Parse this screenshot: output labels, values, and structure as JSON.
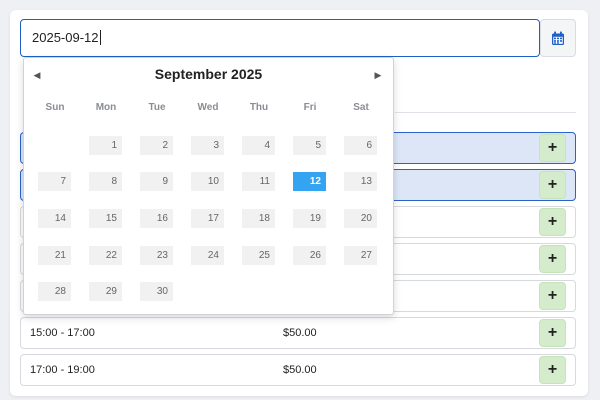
{
  "date_field": {
    "value": "2025-09-12"
  },
  "calendar_button": {
    "icon": "calendar-icon",
    "color": "#1f5fc7"
  },
  "picker": {
    "month_label": "September 2025",
    "prev_icon": "triangle-left-icon",
    "next_icon": "triangle-right-icon",
    "weekdays": [
      "Sun",
      "Mon",
      "Tue",
      "Wed",
      "Thu",
      "Fri",
      "Sat"
    ],
    "weeks": [
      [
        "",
        "1",
        "2",
        "3",
        "4",
        "5",
        "6"
      ],
      [
        "7",
        "8",
        "9",
        "10",
        "11",
        "12",
        "13"
      ],
      [
        "14",
        "15",
        "16",
        "17",
        "18",
        "19",
        "20"
      ],
      [
        "21",
        "22",
        "23",
        "24",
        "25",
        "26",
        "27"
      ],
      [
        "28",
        "29",
        "30",
        "",
        "",
        "",
        ""
      ]
    ],
    "selected_day": "12",
    "selected_color": "#35a4f0"
  },
  "slots": [
    {
      "time": "",
      "price": "",
      "add_label": "+",
      "selected": true
    },
    {
      "time": "",
      "price": "",
      "add_label": "+",
      "selected": true
    },
    {
      "time": "",
      "price": "",
      "add_label": "+",
      "selected": false
    },
    {
      "time": "",
      "price": "",
      "add_label": "+",
      "selected": false
    },
    {
      "time": "",
      "price": "",
      "add_label": "+",
      "selected": false
    },
    {
      "time": "15:00 - 17:00",
      "price": "$50.00",
      "add_label": "+",
      "selected": false
    },
    {
      "time": "17:00 - 19:00",
      "price": "$50.00",
      "add_label": "+",
      "selected": false
    }
  ],
  "colors": {
    "slot_selected_bg": "#dce6f7",
    "slot_selected_border": "#2a63c9",
    "add_button_bg": "#d4eccb"
  }
}
